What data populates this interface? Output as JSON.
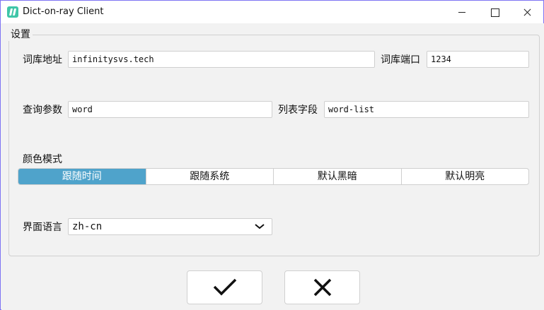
{
  "window": {
    "title": "Dict-on-ray Client"
  },
  "settings": {
    "group_title": "设置",
    "dict_address": {
      "label": "词库地址",
      "value": "infinitysvs.tech"
    },
    "dict_port": {
      "label": "词库端口",
      "value": "1234"
    },
    "query_param": {
      "label": "查询参数",
      "value": "word"
    },
    "list_field": {
      "label": "列表字段",
      "value": "word-list"
    },
    "color_mode": {
      "label": "颜色模式",
      "options": [
        "跟随时间",
        "跟随系统",
        "默认黑暗",
        "默认明亮"
      ],
      "selected_index": 0
    },
    "ui_language": {
      "label": "界面语言",
      "value": "zh-cn"
    }
  },
  "colors": {
    "accent": "#4fa3cb",
    "window_border": "#7f74f3",
    "app_icon": "#3fc6a8"
  },
  "icons": {
    "app": "app-logo-icon",
    "minimize": "minimize-icon",
    "maximize": "maximize-icon",
    "close": "close-icon",
    "dropdown": "chevron-down-icon",
    "confirm": "checkmark-icon",
    "cancel": "x-icon"
  }
}
